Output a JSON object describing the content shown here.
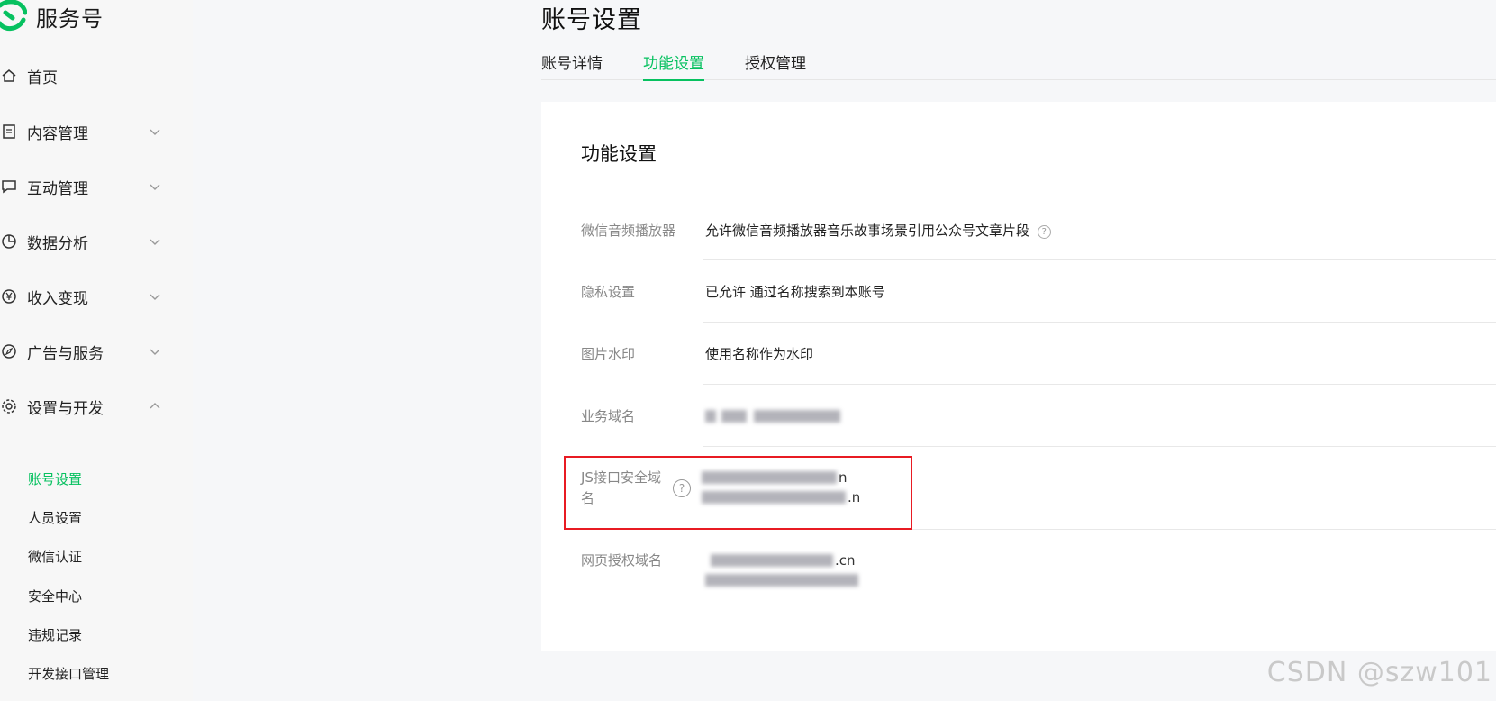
{
  "brand": {
    "name": "服务号"
  },
  "sidebar": {
    "items": [
      {
        "label": "首页",
        "icon": "home-icon",
        "expandable": false
      },
      {
        "label": "内容管理",
        "icon": "document-icon",
        "expandable": true,
        "expanded": false
      },
      {
        "label": "互动管理",
        "icon": "chat-bubble-icon",
        "expandable": true,
        "expanded": false
      },
      {
        "label": "数据分析",
        "icon": "pie-chart-icon",
        "expandable": true,
        "expanded": false
      },
      {
        "label": "收入变现",
        "icon": "yen-icon",
        "expandable": true,
        "expanded": false
      },
      {
        "label": "广告与服务",
        "icon": "compass-icon",
        "expandable": true,
        "expanded": false
      },
      {
        "label": "设置与开发",
        "icon": "gear-icon",
        "expandable": true,
        "expanded": true
      }
    ],
    "sub_items": [
      {
        "label": "账号设置",
        "active": true
      },
      {
        "label": "人员设置",
        "active": false
      },
      {
        "label": "微信认证",
        "active": false
      },
      {
        "label": "安全中心",
        "active": false
      },
      {
        "label": "违规记录",
        "active": false
      },
      {
        "label": "开发接口管理",
        "active": false
      }
    ]
  },
  "main": {
    "title": "账号设置",
    "tabs": [
      {
        "label": "账号详情",
        "active": false
      },
      {
        "label": "功能设置",
        "active": true
      },
      {
        "label": "授权管理",
        "active": false
      }
    ],
    "card_title": "功能设置",
    "rows": [
      {
        "label": "微信音频播放器",
        "value": "允许微信音频播放器音乐故事场景引用公众号文章片段",
        "has_help": true
      },
      {
        "label": "隐私设置",
        "value": "已允许 通过名称搜索到本账号"
      },
      {
        "label": "图片水印",
        "value": "使用名称作为水印"
      },
      {
        "label": "业务域名",
        "value_blurred": true
      },
      {
        "label_line1": "JS接口安全域",
        "label_line2": "名",
        "value_blurred": true,
        "tails": [
          "n",
          ".n"
        ]
      },
      {
        "label": "网页授权域名",
        "value_blurred": true,
        "tails": [
          ".cn",
          ""
        ]
      }
    ]
  },
  "colors": {
    "accent": "#07c160",
    "highlight": "#e81b23"
  },
  "watermark": "CSDN @szw101"
}
